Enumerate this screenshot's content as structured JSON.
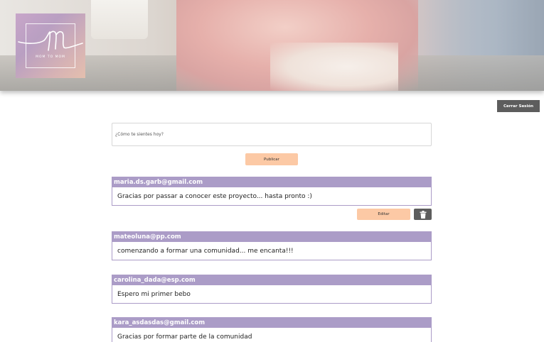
{
  "header": {
    "logo_text": "MOM TO MOM"
  },
  "toolbar": {
    "logout_label": "Cerrar Sesión"
  },
  "composer": {
    "placeholder": "¿Cómo te sientes hoy?",
    "value": "",
    "publish_label": "Publicar"
  },
  "posts": [
    {
      "author": "maria.ds.garb@gmail.com",
      "text": "Gracias por passar a conocer este proyecto... hasta pronto :)",
      "edit_label": "Editar",
      "delete_icon": "trash-icon"
    },
    {
      "author": "mateoluna@pp.com",
      "text": "comenzando a formar una comunidad... me encanta!!!"
    },
    {
      "author": "carolina_dada@esp.com",
      "text": "Espero mi primer bebo"
    },
    {
      "author": "kara_asdasdas@gmail.com",
      "text": "Gracias por formar parte de la comunidad"
    }
  ],
  "colors": {
    "author_bar": "#ab9cc7",
    "accent_button": "#fcc9a5",
    "dark_button": "#5d5d5d"
  }
}
